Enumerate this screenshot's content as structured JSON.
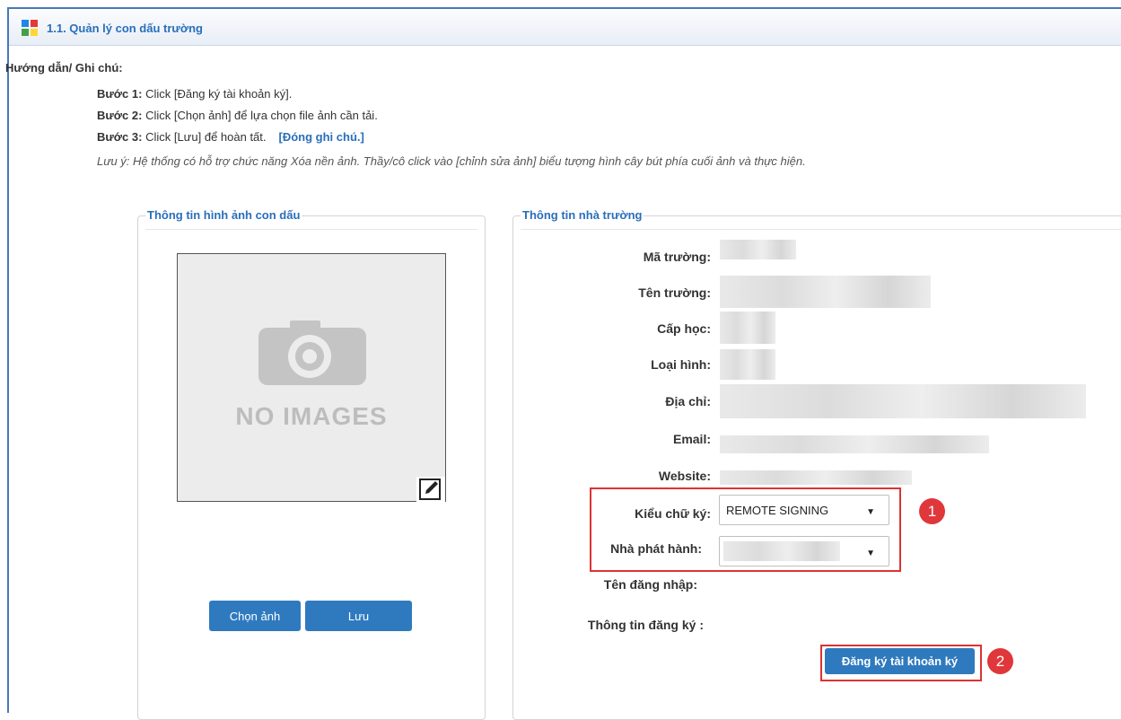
{
  "header": {
    "title": "1.1. Quản lý con dấu trường",
    "logo_colors": [
      "#e53935",
      "#43a047",
      "#1e88e5",
      "#fdd835"
    ]
  },
  "guide": {
    "heading": "Hướng dẫn/ Ghi chú:",
    "steps": [
      {
        "label": "Bước 1:",
        "text": " Click [Đăng ký tài khoản ký]."
      },
      {
        "label": "Bước 2:",
        "text": " Click [Chọn ảnh] để lựa chọn file ảnh cần tải."
      },
      {
        "label": "Bước 3:",
        "text": " Click [Lưu] để hoàn tất."
      }
    ],
    "close_note": "[Đóng ghi chú.]",
    "note": "Lưu ý: Hệ thống có hỗ trợ chức năng Xóa nền ảnh. Thầy/cô click vào [chỉnh sửa ảnh] biểu tượng hình cây bút phía cuối ảnh và thực hiện."
  },
  "image_panel": {
    "legend": "Thông tin hình ảnh con dấu",
    "placeholder": "NO IMAGES",
    "choose_button": "Chọn ảnh",
    "save_button": "Lưu"
  },
  "school_panel": {
    "legend": "Thông tin nhà trường",
    "fields": {
      "code": "Mã trường:",
      "name": "Tên trường:",
      "level": "Cấp học:",
      "type": "Loại hình:",
      "address": "Địa chỉ:",
      "email": "Email:",
      "website": "Website:"
    },
    "sign_type_label": "Kiểu chữ ký:",
    "sign_type_value": "REMOTE SIGNING",
    "publisher_label": "Nhà phát hành:",
    "username_label": "Tên đăng nhập:",
    "register_info_label": "Thông tin đăng ký :",
    "register_button": "Đăng ký tài khoản ký"
  },
  "annotations": {
    "badge1": "1",
    "badge2": "2",
    "highlight_color": "#d33333"
  }
}
